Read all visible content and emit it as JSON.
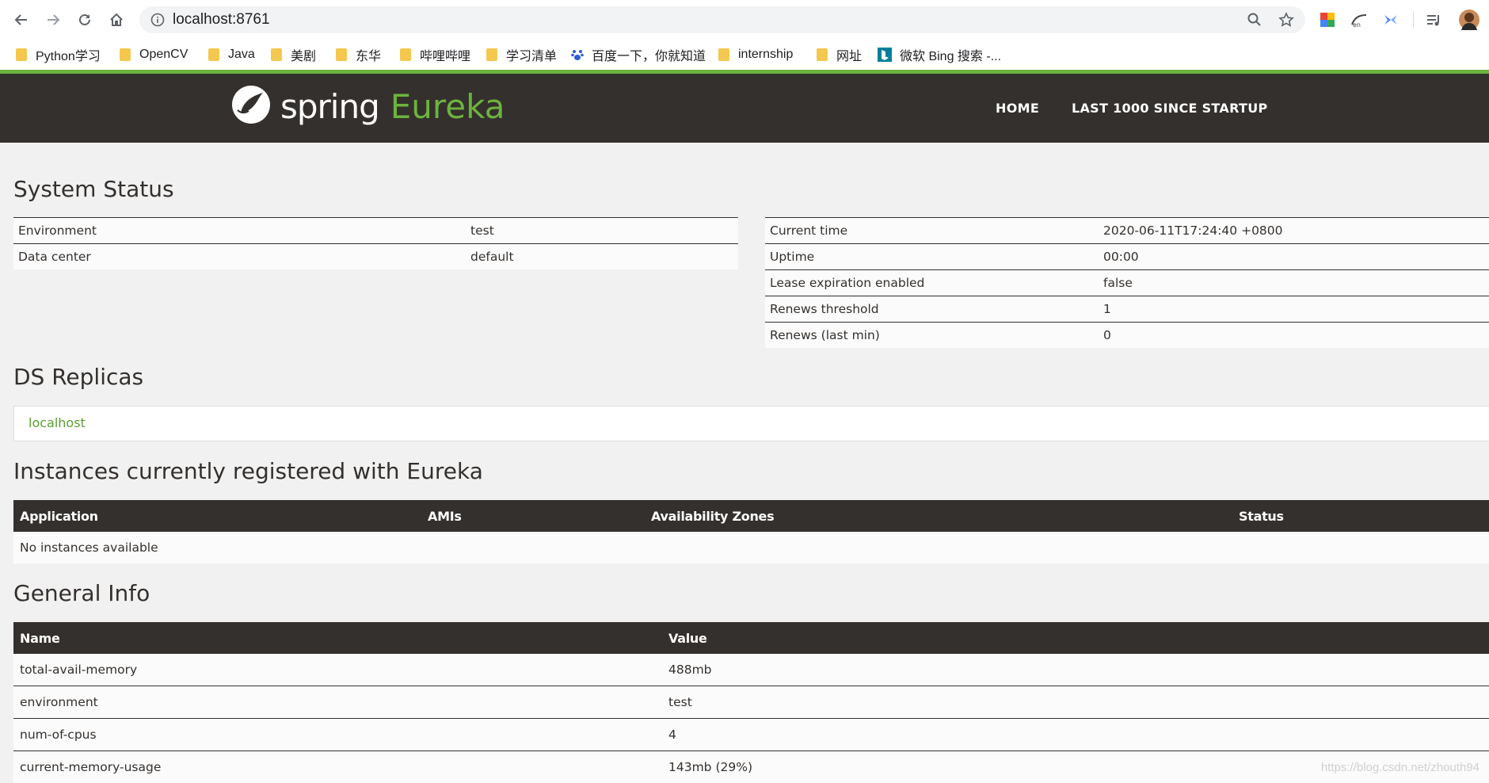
{
  "browser": {
    "url": "localhost:8761",
    "bookmarks": [
      {
        "label": "Python学习",
        "icon": "folder-icon"
      },
      {
        "label": "OpenCV",
        "icon": "folder-icon"
      },
      {
        "label": "Java",
        "icon": "folder-icon"
      },
      {
        "label": "美剧",
        "icon": "folder-icon"
      },
      {
        "label": "东华",
        "icon": "folder-icon"
      },
      {
        "label": "哔哩哔哩",
        "icon": "folder-icon"
      },
      {
        "label": "学习清单",
        "icon": "folder-icon"
      },
      {
        "label": "百度一下，你就知道",
        "icon": "baidu-paw-icon"
      },
      {
        "label": "internship",
        "icon": "folder-icon"
      },
      {
        "label": "网址",
        "icon": "folder-icon"
      },
      {
        "label": "微软 Bing 搜索 -...",
        "icon": "bing-icon"
      }
    ]
  },
  "header": {
    "logo_spring": "spring",
    "logo_eureka": "Eureka",
    "nav": [
      "HOME",
      "LAST 1000 SINCE STARTUP"
    ]
  },
  "system_status": {
    "title": "System Status",
    "left": [
      {
        "name": "Environment",
        "value": "test"
      },
      {
        "name": "Data center",
        "value": "default"
      }
    ],
    "right": [
      {
        "name": "Current time",
        "value": "2020-06-11T17:24:40 +0800"
      },
      {
        "name": "Uptime",
        "value": "00:00"
      },
      {
        "name": "Lease expiration enabled",
        "value": "false"
      },
      {
        "name": "Renews threshold",
        "value": "1"
      },
      {
        "name": "Renews (last min)",
        "value": "0"
      }
    ]
  },
  "replicas": {
    "title": "DS Replicas",
    "items": [
      "localhost"
    ]
  },
  "instances": {
    "title": "Instances currently registered with Eureka",
    "columns": [
      "Application",
      "AMIs",
      "Availability Zones",
      "Status"
    ],
    "empty_text": "No instances available"
  },
  "general_info": {
    "title": "General Info",
    "columns": [
      "Name",
      "Value"
    ],
    "rows": [
      {
        "name": "total-avail-memory",
        "value": "488mb"
      },
      {
        "name": "environment",
        "value": "test"
      },
      {
        "name": "num-of-cpus",
        "value": "4"
      },
      {
        "name": "current-memory-usage",
        "value": "143mb (29%)"
      }
    ]
  },
  "watermark": "https://blog.csdn.net/zhouth94",
  "colors": {
    "accent": "#6db33f",
    "dark": "#34302d",
    "page_bg": "#f1f1f1"
  }
}
